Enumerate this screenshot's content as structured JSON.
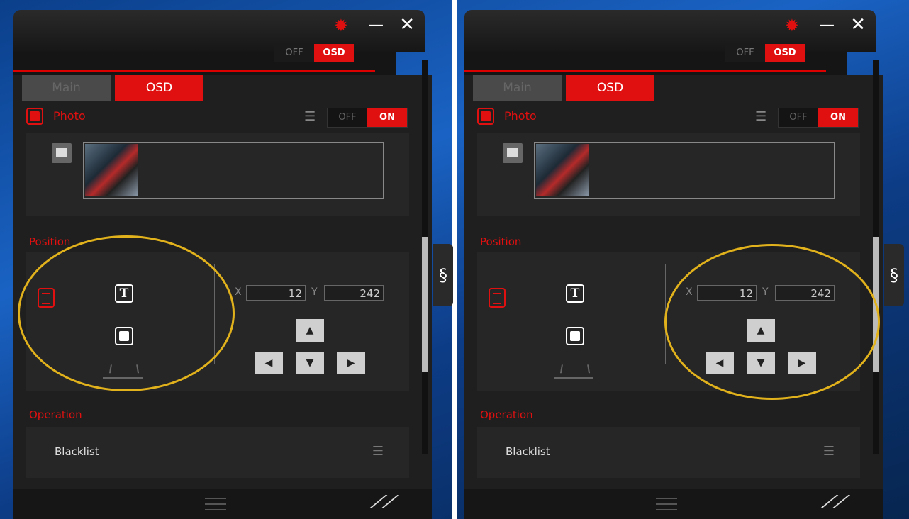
{
  "windows": [
    {
      "header_toggle": {
        "off": "OFF",
        "on": "OSD"
      },
      "tabs": [
        "Main",
        "OSD"
      ],
      "photo": {
        "label": "Photo",
        "toggle_off": "OFF",
        "toggle_on": "ON"
      },
      "position": {
        "title": "Position",
        "x_label": "X",
        "x_value": "12",
        "y_label": "Y",
        "y_value": "242"
      },
      "operation": {
        "title": "Operation",
        "item": "Blacklist"
      },
      "highlight": "monitor"
    },
    {
      "header_toggle": {
        "off": "OFF",
        "on": "OSD"
      },
      "tabs": [
        "Main",
        "OSD"
      ],
      "photo": {
        "label": "Photo",
        "toggle_off": "OFF",
        "toggle_on": "ON"
      },
      "position": {
        "title": "Position",
        "x_label": "X",
        "x_value": "12",
        "y_label": "Y",
        "y_value": "242"
      },
      "operation": {
        "title": "Operation",
        "item": "Blacklist"
      },
      "highlight": "coordinates"
    }
  ],
  "icons": {
    "gear": "gear-icon",
    "minimize": "minimize-icon",
    "close": "close-icon",
    "sliders": "sliders-icon",
    "image": "image-icon",
    "list": "list-icon",
    "text": "text-icon",
    "photo_layer": "photo-layer-icon",
    "arrow_up": "arrow-up-icon",
    "arrow_left": "arrow-left-icon",
    "arrow_down": "arrow-down-icon",
    "arrow_right": "arrow-right-icon",
    "side_tab": "link-icon",
    "footer_menu": "menu-icon",
    "rog_logo": "rog-logo-icon"
  },
  "colors": {
    "accent": "#e01010",
    "highlight": "#e2b21c",
    "panel": "#1f1f1f"
  }
}
